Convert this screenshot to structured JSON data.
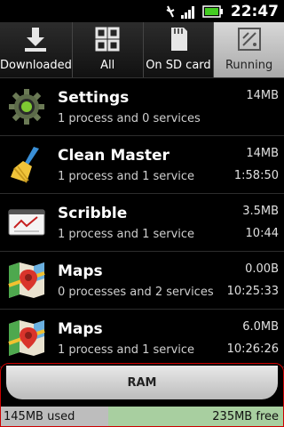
{
  "status_bar": {
    "time": "22:47",
    "icons": [
      "silent-mode-icon",
      "signal-strength-icon",
      "battery-icon"
    ]
  },
  "tabs": [
    {
      "label": "Downloaded",
      "icon": "download-icon",
      "active": false
    },
    {
      "label": "All",
      "icon": "grid-icon",
      "active": false
    },
    {
      "label": "On SD card",
      "icon": "sd-card-icon",
      "active": false
    },
    {
      "label": "Running",
      "icon": "running-apps-icon",
      "active": true
    }
  ],
  "processes": [
    {
      "name": "Settings",
      "detail": "1 process and 0 services",
      "size": "14MB",
      "time": "",
      "icon": "settings-gear-icon"
    },
    {
      "name": "Clean Master",
      "detail": "1 process and 1 service",
      "size": "14MB",
      "time": "1:58:50",
      "icon": "broom-icon"
    },
    {
      "name": "Scribble",
      "detail": "1 process and 1 service",
      "size": "3.5MB",
      "time": "10:44",
      "icon": "scribble-pad-icon"
    },
    {
      "name": "Maps",
      "detail": "0 processes and 2 services",
      "size": "0.00B",
      "time": "10:25:33",
      "icon": "maps-icon"
    },
    {
      "name": "Maps",
      "detail": "1 process and 1 service",
      "size": "6.0MB",
      "time": "10:26:26",
      "icon": "maps-icon"
    }
  ],
  "ram": {
    "label": "RAM",
    "used": "145MB used",
    "free": "235MB free",
    "used_fraction": 0.38
  },
  "colors": {
    "ram_free_bar": "#a8cfa0",
    "ram_used_bar": "#bdbdbd",
    "battery_green": "#44cc22",
    "panel_border": "#cc0000"
  }
}
